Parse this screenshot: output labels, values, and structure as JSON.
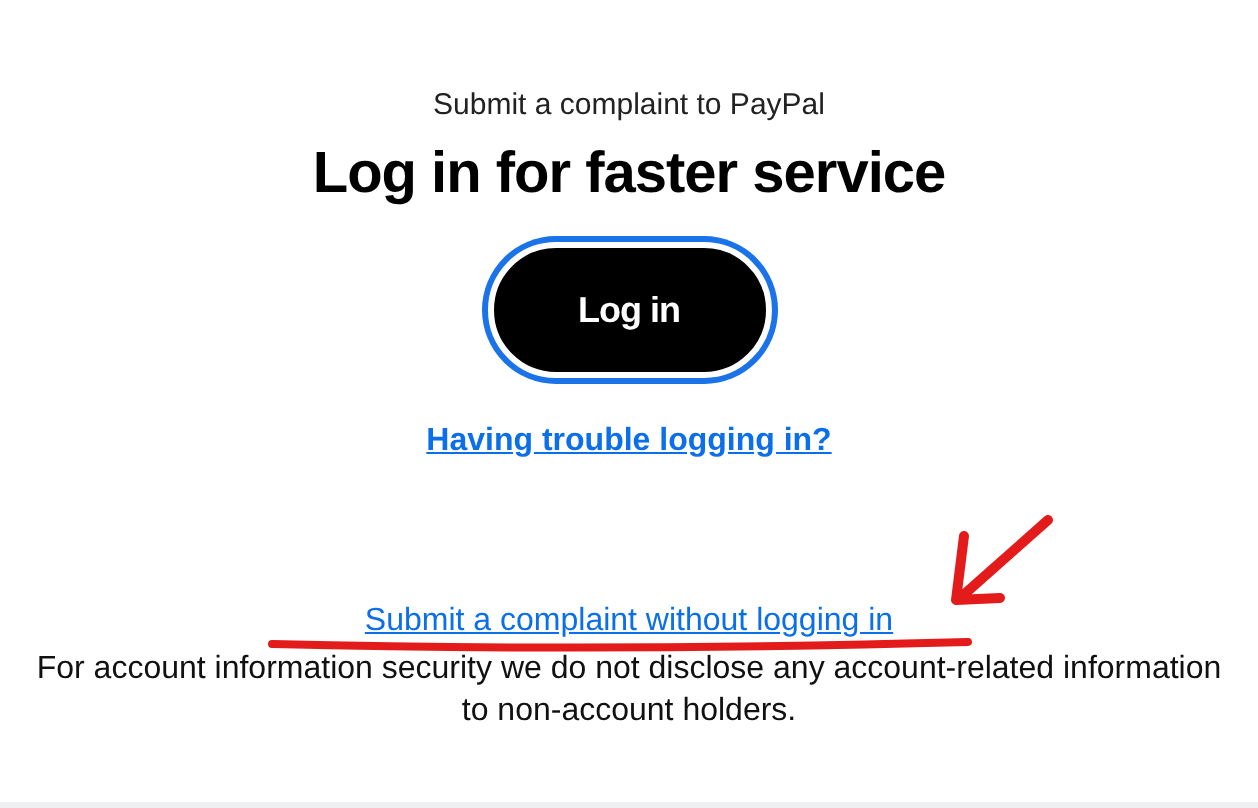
{
  "subtitle": "Submit a complaint to PayPal",
  "heading": "Log in for faster service",
  "login_button": {
    "label": "Log in",
    "focused": true
  },
  "trouble_link": "Having trouble logging in?",
  "complaint_link": "Submit a complaint without logging in",
  "notice": "For account information security we do not disclose any account-related information to non-account holders."
}
